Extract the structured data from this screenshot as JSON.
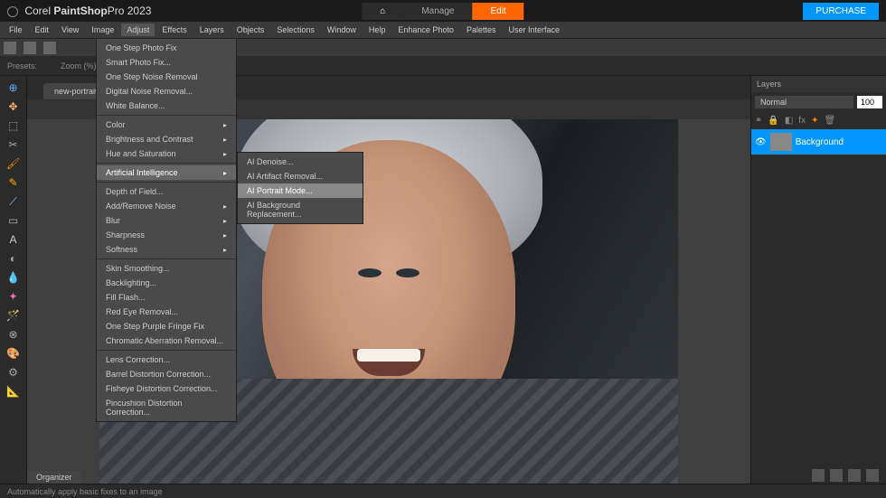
{
  "titlebar": {
    "brand": "Corel",
    "product_part1": "PaintShop",
    "product_part2": "Pro 2023",
    "home_label": "⌂",
    "manage_label": "Manage",
    "edit_label": "Edit",
    "purchase_label": "PURCHASE"
  },
  "menubar": {
    "items": [
      "File",
      "Edit",
      "View",
      "Image",
      "Adjust",
      "Effects",
      "Layers",
      "Objects",
      "Selections",
      "Window",
      "Help",
      "Enhance Photo",
      "Palettes",
      "User Interface"
    ],
    "active_index": 4
  },
  "toolbar2": {
    "presets_label": "Presets:",
    "zoom_label": "Zoom (%)"
  },
  "tabs": {
    "file_tab": "new-portrait.P..."
  },
  "adjust_menu": {
    "items": [
      {
        "label": "One Step Photo Fix",
        "type": "item"
      },
      {
        "label": "Smart Photo Fix...",
        "type": "item"
      },
      {
        "label": "One Step Noise Removal",
        "type": "item"
      },
      {
        "label": "Digital Noise Removal...",
        "type": "item"
      },
      {
        "label": "White Balance...",
        "type": "item"
      },
      {
        "type": "sep"
      },
      {
        "label": "Color",
        "type": "sub"
      },
      {
        "label": "Brightness and Contrast",
        "type": "sub"
      },
      {
        "label": "Hue and Saturation",
        "type": "sub"
      },
      {
        "type": "sep"
      },
      {
        "label": "Artificial Intelligence",
        "type": "sub",
        "highlighted": true
      },
      {
        "type": "sep"
      },
      {
        "label": "Depth of Field...",
        "type": "item"
      },
      {
        "label": "Add/Remove Noise",
        "type": "sub"
      },
      {
        "label": "Blur",
        "type": "sub"
      },
      {
        "label": "Sharpness",
        "type": "sub"
      },
      {
        "label": "Softness",
        "type": "sub"
      },
      {
        "type": "sep"
      },
      {
        "label": "Skin Smoothing...",
        "type": "item"
      },
      {
        "label": "Backlighting...",
        "type": "item"
      },
      {
        "label": "Fill Flash...",
        "type": "item"
      },
      {
        "label": "Red Eye Removal...",
        "type": "item"
      },
      {
        "label": "One Step Purple Fringe Fix",
        "type": "item"
      },
      {
        "label": "Chromatic Aberration Removal...",
        "type": "item"
      },
      {
        "type": "sep"
      },
      {
        "label": "Lens Correction...",
        "type": "item"
      },
      {
        "label": "Barrel Distortion Correction...",
        "type": "item"
      },
      {
        "label": "Fisheye Distortion Correction...",
        "type": "item"
      },
      {
        "label": "Pincushion Distortion Correction...",
        "type": "item"
      }
    ]
  },
  "ai_submenu": {
    "items": [
      {
        "label": "AI Denoise...",
        "highlighted": false
      },
      {
        "label": "AI Artifact Removal...",
        "highlighted": false
      },
      {
        "label": "AI Portrait Mode...",
        "highlighted": true
      },
      {
        "label": "AI Background Replacement...",
        "highlighted": false
      }
    ]
  },
  "layers_panel": {
    "title": "Layers",
    "blend_mode": "Normal",
    "opacity": "100",
    "layer_name": "Background"
  },
  "organizer": {
    "label": "Organizer"
  },
  "statusbar": {
    "hint": "Automatically apply basic fixes to an image"
  }
}
